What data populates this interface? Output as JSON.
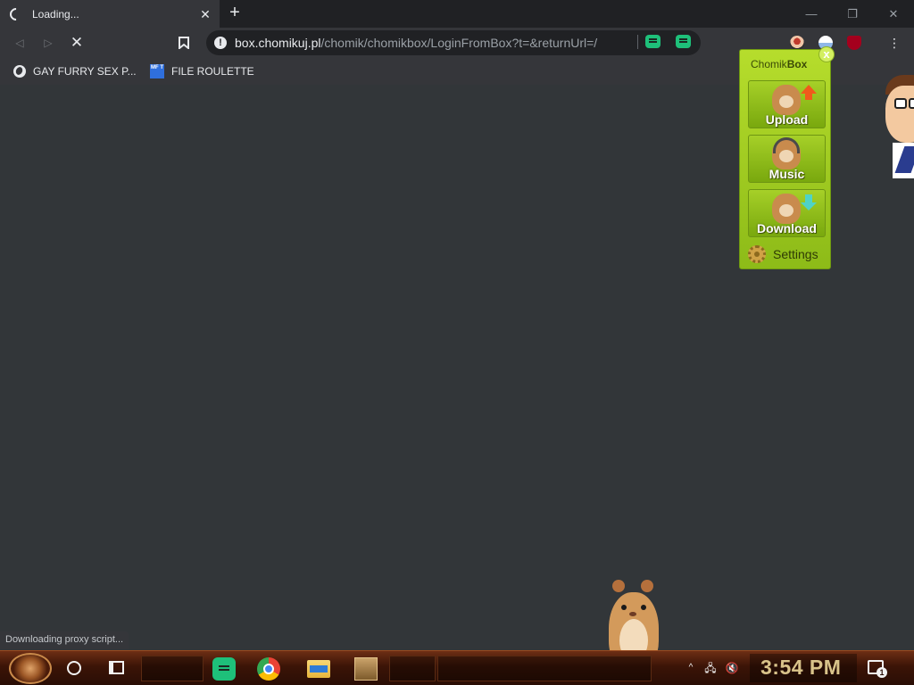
{
  "browser": {
    "tab": {
      "title": "Loading...",
      "close_glyph": "✕",
      "status": "loading"
    },
    "new_tab_glyph": "+",
    "window_controls": {
      "minimize": "—",
      "restore": "❐",
      "close": "✕"
    },
    "nav": {
      "back_glyph": "◁",
      "forward_glyph": "▷",
      "stop_glyph": "✕"
    },
    "omnibox": {
      "security_icon": "info-icon",
      "info_glyph": "!",
      "host": "box.chomikuj.pl",
      "path": "/chomik/chomikbox/LoginFromBox?t=&returnUrl=/"
    },
    "menu_glyph": "⋮",
    "extensions": [
      "green-chat-extension",
      "green-chat-extension",
      "avatar-extension",
      "globe-extension",
      "ublock-extension"
    ]
  },
  "bookmarks": [
    {
      "label": "GAY FURRY SEX P...",
      "icon": "globe-icon"
    },
    {
      "label": "FILE ROULETTE",
      "icon": "mft-icon",
      "icon_text": "MF T"
    }
  ],
  "status_bar": "Downloading proxy script...",
  "chomikbox": {
    "title_prefix": "Chomik",
    "title_bold": "Box",
    "close_glyph": "x",
    "buttons": [
      {
        "label": "Upload",
        "icon": "hamster-upload-icon"
      },
      {
        "label": "Music",
        "icon": "hamster-headphones-icon"
      },
      {
        "label": "Download",
        "icon": "hamster-download-icon"
      }
    ],
    "settings_label": "Settings"
  },
  "taskbar": {
    "apps": [
      "green-chat-app",
      "chrome-app",
      "file-explorer-app",
      "chomikbox-app"
    ],
    "tray": {
      "network_glyph": "🖧",
      "volume_glyph": "🔇",
      "chevron_glyph": "^"
    },
    "clock": "3:54 PM",
    "notification_count": "1"
  },
  "colors": {
    "chrome_bg": "#202124",
    "toolbar_bg": "#35363a",
    "content_bg": "#323639",
    "chomikbox_green": "#a6d028",
    "taskbar_brown": "#3b1407",
    "clock_gold": "#d9c38a"
  }
}
